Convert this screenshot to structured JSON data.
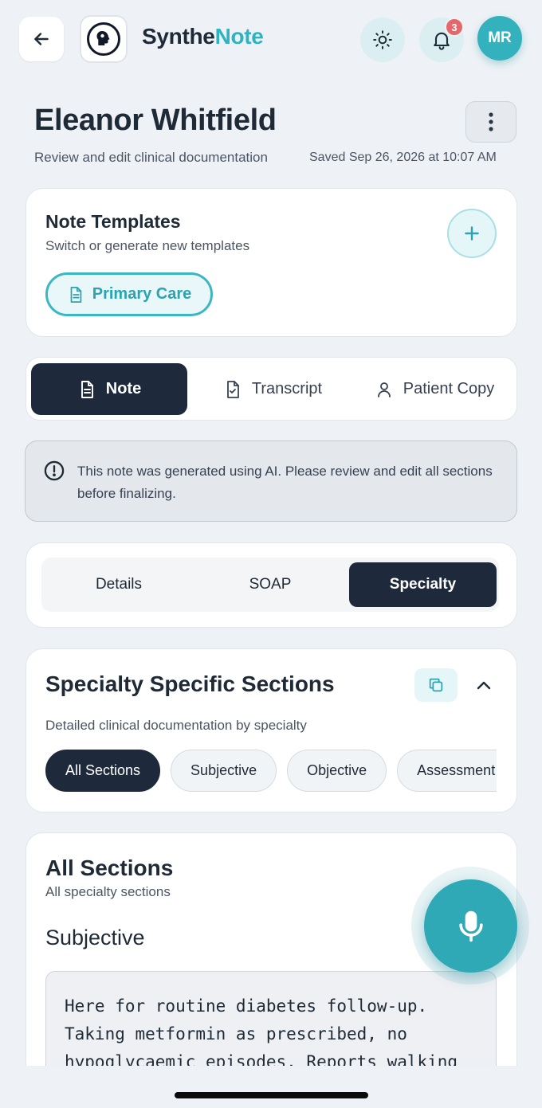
{
  "header": {
    "brand_part1": "Synthe",
    "brand_part2": "Note",
    "notification_count": "3",
    "avatar_initials": "MR",
    "colors": {
      "brand_accent": "#2fb3c0",
      "badge": "#e5676a",
      "dark": "#1e293b"
    }
  },
  "page": {
    "patient_name": "Eleanor Whitfield",
    "subtitle": "Review and edit clinical documentation",
    "saved_status": "Saved Sep 26, 2026 at 10:07 AM"
  },
  "templates": {
    "title": "Note Templates",
    "subtitle": "Switch or generate new templates",
    "selected_template": "Primary Care"
  },
  "tabs": [
    {
      "label": "Note",
      "active": true
    },
    {
      "label": "Transcript",
      "active": false
    },
    {
      "label": "Patient Copy",
      "active": false
    }
  ],
  "ai_notice": {
    "text": "This note was generated using AI. Please review and edit all sections before finalizing."
  },
  "segments": [
    {
      "label": "Details",
      "active": false
    },
    {
      "label": "SOAP",
      "active": false
    },
    {
      "label": "Specialty",
      "active": true
    }
  ],
  "specialty": {
    "title": "Specialty Specific Sections",
    "subtitle": "Detailed clinical documentation by specialty",
    "chips": [
      {
        "label": "All Sections",
        "active": true
      },
      {
        "label": "Subjective",
        "active": false
      },
      {
        "label": "Objective",
        "active": false
      },
      {
        "label": "Assessment",
        "active": false
      }
    ]
  },
  "sections": {
    "title": "All Sections",
    "subtitle": "All specialty sections",
    "subjective_heading": "Subjective",
    "subjective_text": "Here for routine diabetes follow-up. Taking metformin as prescribed, no hypoglycaemic episodes. Reports walking"
  }
}
